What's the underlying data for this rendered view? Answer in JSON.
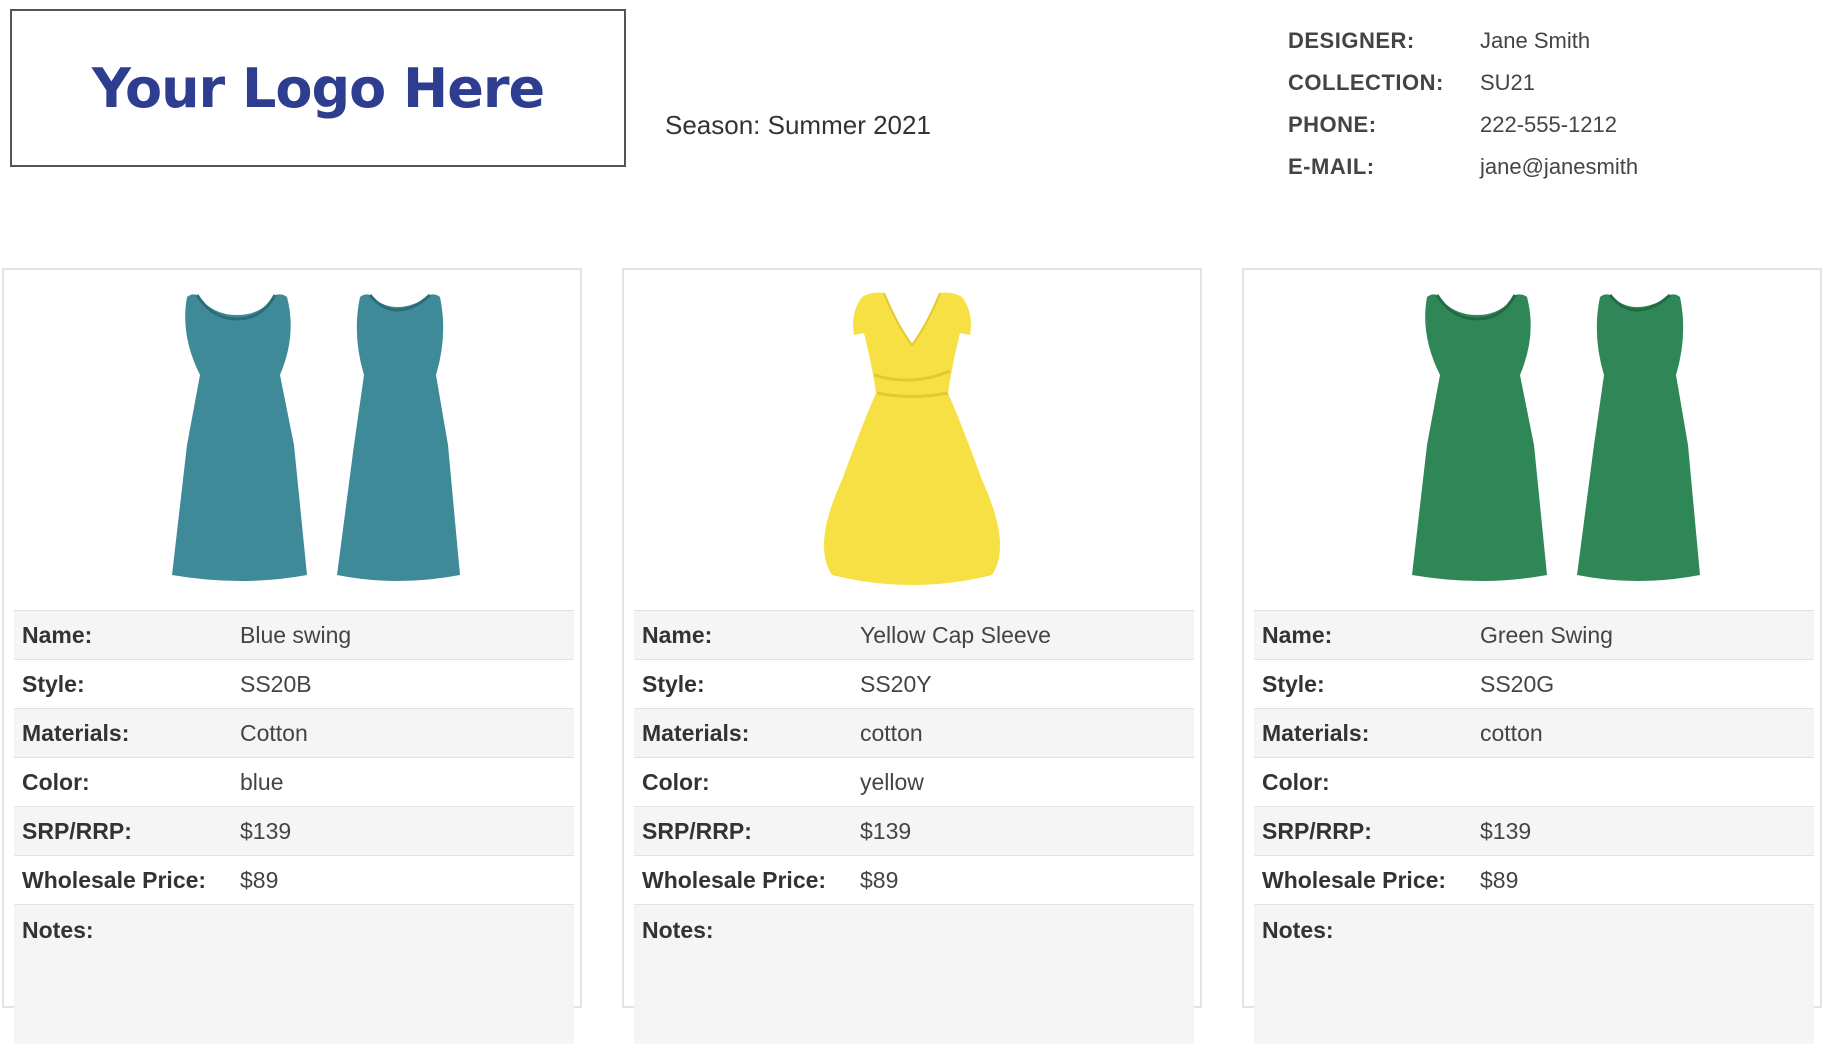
{
  "header": {
    "logo_text": "Your Logo Here",
    "season": "Season: Summer 2021"
  },
  "contact": [
    {
      "label": "DESIGNER:",
      "value": "Jane Smith"
    },
    {
      "label": "COLLECTION:",
      "value": "SU21"
    },
    {
      "label": "PHONE:",
      "value": "222-555-1212"
    },
    {
      "label": "E-MAIL:",
      "value": "jane@janesmith"
    }
  ],
  "products": [
    {
      "image": "blue-swing-dress-front-and-back",
      "dress_color": "#3f8a99",
      "rows": [
        {
          "label": "Name:",
          "value": "Blue swing"
        },
        {
          "label": "Style:",
          "value": "SS20B"
        },
        {
          "label": "Materials:",
          "value": "Cotton"
        },
        {
          "label": "Color:",
          "value": "blue"
        },
        {
          "label": "SRP/RRP:",
          "value": "$139"
        },
        {
          "label": "Wholesale Price:",
          "value": "$89"
        },
        {
          "label": "Notes:",
          "value": ""
        }
      ]
    },
    {
      "image": "yellow-cap-sleeve-dress",
      "dress_color": "#f7e043",
      "rows": [
        {
          "label": "Name:",
          "value": "Yellow Cap Sleeve"
        },
        {
          "label": "Style:",
          "value": "SS20Y"
        },
        {
          "label": "Materials:",
          "value": "cotton"
        },
        {
          "label": "Color:",
          "value": "yellow"
        },
        {
          "label": "SRP/RRP:",
          "value": "$139"
        },
        {
          "label": "Wholesale Price:",
          "value": "$89"
        },
        {
          "label": "Notes:",
          "value": ""
        }
      ]
    },
    {
      "image": "green-swing-dress-front-and-back",
      "dress_color": "#2f8757",
      "rows": [
        {
          "label": "Name:",
          "value": "Green Swing"
        },
        {
          "label": "Style:",
          "value": "SS20G"
        },
        {
          "label": "Materials:",
          "value": "cotton"
        },
        {
          "label": "Color:",
          "value": ""
        },
        {
          "label": "SRP/RRP:",
          "value": "$139"
        },
        {
          "label": "Wholesale Price:",
          "value": "$89"
        },
        {
          "label": "Notes:",
          "value": ""
        }
      ]
    }
  ]
}
